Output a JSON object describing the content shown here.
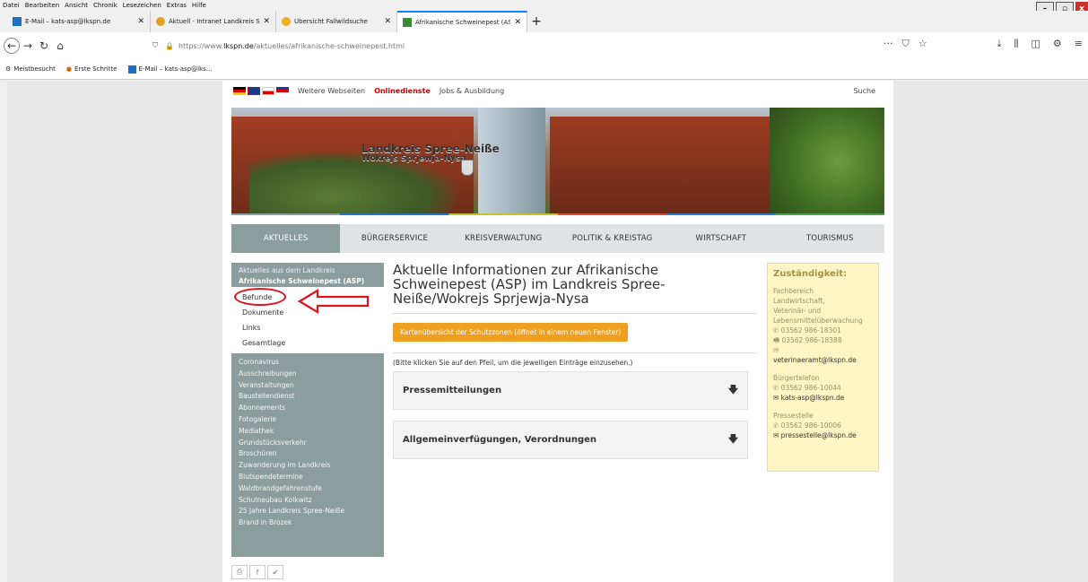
{
  "menubar": [
    "Datei",
    "Bearbeiten",
    "Ansicht",
    "Chronik",
    "Lesezeichen",
    "Extras",
    "Hilfe"
  ],
  "tabs": [
    {
      "title": "E-Mail – kats-asp@lkspn.de",
      "color": "#1f6fc4"
    },
    {
      "title": "Aktuell - Intranet Landkreis Spr",
      "color": "#e2a020"
    },
    {
      "title": "Übersicht Fallwildsuche",
      "color": "#f0b020"
    },
    {
      "title": "Afrikanische Schweinepest (AS",
      "color": "#3a8a3a"
    }
  ],
  "url": {
    "prefix": "https://www.",
    "host": "lkspn.de",
    "path": "/aktuelles/afrikanische-schweinepest.html"
  },
  "bookmarks": [
    "Meistbesucht",
    "Erste Schritte",
    "E-Mail – kats-asp@lks..."
  ],
  "topbar": {
    "weitere": "Weitere Webseiten",
    "online": "Onlinedienste",
    "jobs": "Jobs & Ausbildung",
    "search": "Suche"
  },
  "banner": {
    "sign1": "Landkreis Spree-Neiße",
    "sign2": "Wokrejs Sprjewja-Nysa"
  },
  "mainnav": [
    "AKTUELLES",
    "BÜRGERSERVICE",
    "KREISVERWALTUNG",
    "POLITIK & KREISTAG",
    "WIRTSCHAFT",
    "TOURISMUS"
  ],
  "leftnav": {
    "top": "Aktuelles aus dem Landkreis",
    "asp": "Afrikanische Schweinepest (ASP)",
    "sub": [
      "Befunde",
      "Dokumente",
      "Links",
      "Gesamtlage"
    ],
    "list": [
      "Coronavirus",
      "Ausschreibungen",
      "Veranstaltungen",
      "Baustellendienst",
      "Abonnements",
      "Fotogalerie",
      "Mediathek",
      "Grundstücksverkehr",
      "Broschüren",
      "Zuwanderung im Landkreis",
      "Blutspendetermine",
      "Waldbrandgefahrenstufe",
      "Schulneubau Kolkwitz",
      "25 Jahre Landkreis Spree-Neiße",
      "Brand in Brozek"
    ]
  },
  "content": {
    "title": "Aktuelle Informationen zur Afrikanische Schweinepest (ASP) im Landkreis Spree-Neiße/Wokrejs Sprjewja-Nysa",
    "button": "Kartenübersicht der Schutzzonen (öffnet in einem neuen Fenster)",
    "hint": "(Bitte klicken Sie auf den Pfeil, um die jeweiligen Einträge einzusehen.)",
    "accordions": [
      "Pressemitteilungen",
      "Allgemeinverfügungen, Verordnungen"
    ]
  },
  "sidebox": {
    "title": "Zuständigkeit:",
    "dept1": "Fachbereich",
    "dept2": "Landwirtschaft,",
    "dept3": "Veterinär- und",
    "dept4": "Lebensmittelüberwachung",
    "tel1": "03562 986-18301",
    "fax1": "03562 986-18388",
    "mail1": "veterinaeramt@lkspn.de",
    "bt_label": "Bürgertelefon",
    "bt_tel": "03562 986-10044",
    "bt_mail": "kats-asp@lkspn.de",
    "ps_label": "Pressestelle",
    "ps_tel": "03562 986-10006",
    "ps_mail": "pressestelle@lkspn.de"
  }
}
